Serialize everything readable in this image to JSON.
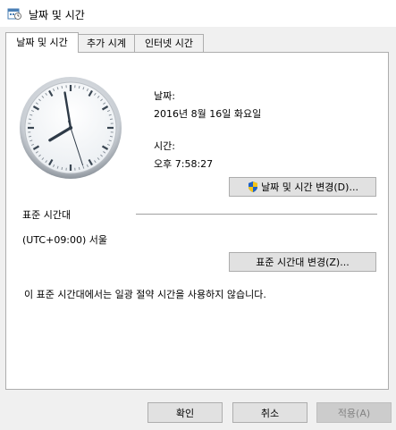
{
  "window": {
    "title": "날짜 및 시간",
    "icon": "date-time-icon"
  },
  "tabs": [
    {
      "label": "날짜 및 시간",
      "active": true
    },
    {
      "label": "추가 시계",
      "active": false
    },
    {
      "label": "인터넷 시간",
      "active": false
    }
  ],
  "date_section": {
    "date_label": "날짜:",
    "date_value": "2016년 8월 16일 화요일",
    "time_label": "시간:",
    "time_value": "오후 7:58:27",
    "change_button": "날짜 및 시간 변경(D)...",
    "change_button_icon": "uac-shield-icon"
  },
  "timezone_section": {
    "header": "표준 시간대",
    "value": "(UTC+09:00) 서울",
    "change_button": "표준 시간대 변경(Z)...",
    "dst_note": "이 표준 시간대에서는 일광 절약 시간을 사용하지 않습니다."
  },
  "clock": {
    "hours": 19,
    "minutes": 58,
    "seconds": 27
  },
  "footer": {
    "ok": "확인",
    "cancel": "취소",
    "apply": "적용(A)"
  },
  "colors": {
    "accent_shield_blue": "#1e62c8",
    "accent_shield_yellow": "#f5c518"
  }
}
